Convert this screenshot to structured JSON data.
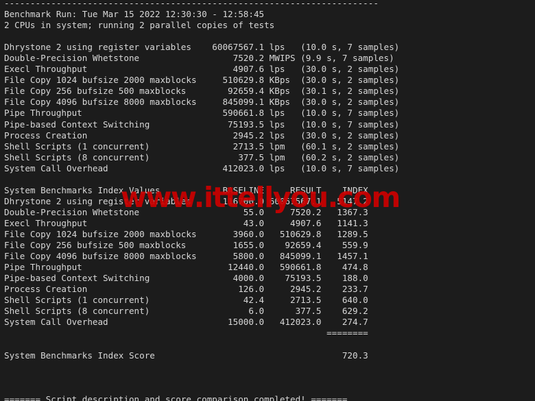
{
  "terminal": {
    "background_color": "#1c1c1c",
    "text_color": "#d8d8d8",
    "columns": 100,
    "rows": 37
  },
  "watermark": {
    "text": "www.ittellyou.com",
    "color": "#cc0000"
  },
  "header": {
    "rule": "------------------------------------------------------------------------",
    "benchmark_run": "Benchmark Run: Tue Mar 15 2022 12:30:30 - 12:58:45",
    "cpu_info": "2 CPUs in system; running 2 parallel copies of tests"
  },
  "raw_results": {
    "rows": [
      {
        "name": "Dhrystone 2 using register variables",
        "value": "60067567.1",
        "unit": "lps",
        "timing": "(10.0 s, 7 samples)"
      },
      {
        "name": "Double-Precision Whetstone",
        "value": "7520.2",
        "unit": "MWIPS",
        "timing": "(9.9 s, 7 samples)"
      },
      {
        "name": "Execl Throughput",
        "value": "4907.6",
        "unit": "lps",
        "timing": "(30.0 s, 2 samples)"
      },
      {
        "name": "File Copy 1024 bufsize 2000 maxblocks",
        "value": "510629.8",
        "unit": "KBps",
        "timing": "(30.0 s, 2 samples)"
      },
      {
        "name": "File Copy 256 bufsize 500 maxblocks",
        "value": "92659.4",
        "unit": "KBps",
        "timing": "(30.1 s, 2 samples)"
      },
      {
        "name": "File Copy 4096 bufsize 8000 maxblocks",
        "value": "845099.1",
        "unit": "KBps",
        "timing": "(30.0 s, 2 samples)"
      },
      {
        "name": "Pipe Throughput",
        "value": "590661.8",
        "unit": "lps",
        "timing": "(10.0 s, 7 samples)"
      },
      {
        "name": "Pipe-based Context Switching",
        "value": "75193.5",
        "unit": "lps",
        "timing": "(10.0 s, 7 samples)"
      },
      {
        "name": "Process Creation",
        "value": "2945.2",
        "unit": "lps",
        "timing": "(30.0 s, 2 samples)"
      },
      {
        "name": "Shell Scripts (1 concurrent)",
        "value": "2713.5",
        "unit": "lpm",
        "timing": "(60.1 s, 2 samples)"
      },
      {
        "name": "Shell Scripts (8 concurrent)",
        "value": "377.5",
        "unit": "lpm",
        "timing": "(60.2 s, 2 samples)"
      },
      {
        "name": "System Call Overhead",
        "value": "412023.0",
        "unit": "lps",
        "timing": "(10.0 s, 7 samples)"
      }
    ]
  },
  "index_table": {
    "title": "System Benchmarks Index Values",
    "headers": [
      "BASELINE",
      "RESULT",
      "INDEX"
    ],
    "rows": [
      {
        "name": "Dhrystone 2 using register variables",
        "baseline": "116700.0",
        "result": "60067567.1",
        "index": "5147.2"
      },
      {
        "name": "Double-Precision Whetstone",
        "baseline": "55.0",
        "result": "7520.2",
        "index": "1367.3"
      },
      {
        "name": "Execl Throughput",
        "baseline": "43.0",
        "result": "4907.6",
        "index": "1141.3"
      },
      {
        "name": "File Copy 1024 bufsize 2000 maxblocks",
        "baseline": "3960.0",
        "result": "510629.8",
        "index": "1289.5"
      },
      {
        "name": "File Copy 256 bufsize 500 maxblocks",
        "baseline": "1655.0",
        "result": "92659.4",
        "index": "559.9"
      },
      {
        "name": "File Copy 4096 bufsize 8000 maxblocks",
        "baseline": "5800.0",
        "result": "845099.1",
        "index": "1457.1"
      },
      {
        "name": "Pipe Throughput",
        "baseline": "12440.0",
        "result": "590661.8",
        "index": "474.8"
      },
      {
        "name": "Pipe-based Context Switching",
        "baseline": "4000.0",
        "result": "75193.5",
        "index": "188.0"
      },
      {
        "name": "Process Creation",
        "baseline": "126.0",
        "result": "2945.2",
        "index": "233.7"
      },
      {
        "name": "Shell Scripts (1 concurrent)",
        "baseline": "42.4",
        "result": "2713.5",
        "index": "640.0"
      },
      {
        "name": "Shell Scripts (8 concurrent)",
        "baseline": "6.0",
        "result": "377.5",
        "index": "629.2"
      },
      {
        "name": "System Call Overhead",
        "baseline": "15000.0",
        "result": "412023.0",
        "index": "274.7"
      }
    ],
    "separator": "========",
    "score_label": "System Benchmarks Index Score",
    "score_value": "720.3"
  },
  "footer": {
    "completion_message": "======= Script description and score comparison completed! ======="
  }
}
